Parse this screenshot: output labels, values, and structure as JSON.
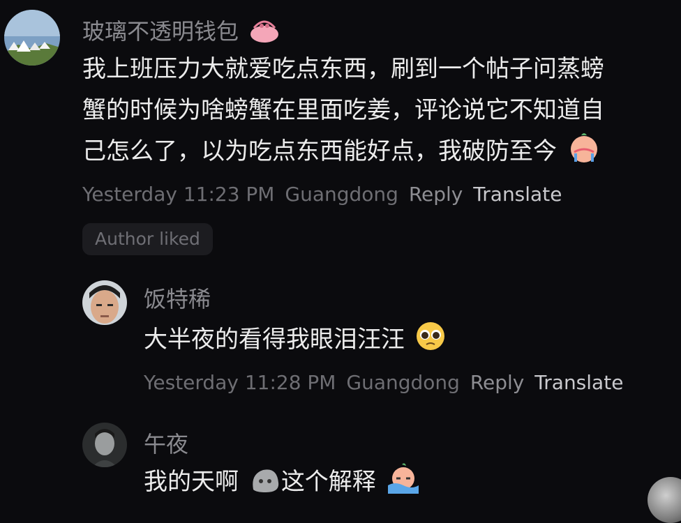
{
  "comments": [
    {
      "username": "玻璃不透明钱包",
      "body_lines": [
        "我上班压力大就爱吃点东西，刷到一个帖子问蒸螃",
        "蟹的时候为啥螃蟹在里面吃姜，评论说它不知道自",
        "己怎么了，以为吃点东西能好点，我破防至今"
      ],
      "time": "Yesterday 11:23 PM",
      "location": "Guangdong",
      "reply_label": "Reply",
      "translate_label": "Translate",
      "badge": "Author liked",
      "name_emoji": "purse-emoji",
      "body_emoji": "crying-face-emoji"
    },
    {
      "username": "饭特稀",
      "body": "大半夜的看得我眼泪汪汪",
      "time": "Yesterday 11:28 PM",
      "location": "Guangdong",
      "reply_label": "Reply",
      "translate_label": "Translate",
      "body_emoji": "pleading-face-emoji"
    },
    {
      "username": "午夜",
      "body_before": "我的天啊",
      "body_after": "这个解释",
      "emoji_1": "stone-face-emoji",
      "emoji_2": "crying-in-water-emoji"
    }
  ]
}
